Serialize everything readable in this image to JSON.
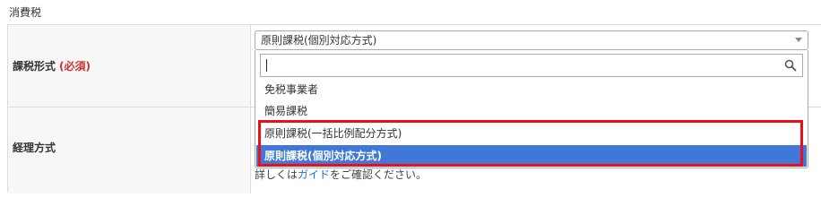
{
  "section": {
    "title": "消費税"
  },
  "row1": {
    "label": "課税形式",
    "required": "(必須)",
    "select": {
      "value": "原則課税(個別対応方式)",
      "search_placeholder": "",
      "options": [
        "免税事業者",
        "簡易課税",
        "原則課税(一括比例配分方式)",
        "原則課税(個別対応方式)"
      ],
      "selected_index": 3
    }
  },
  "row2": {
    "label": "経理方式",
    "help_prefix": "詳しくは",
    "help_link": "ガイド",
    "help_suffix": "をご確認ください。"
  },
  "colors": {
    "selected_bg": "#4178d6",
    "highlight_border": "#e8101a",
    "required": "#cc3333"
  }
}
